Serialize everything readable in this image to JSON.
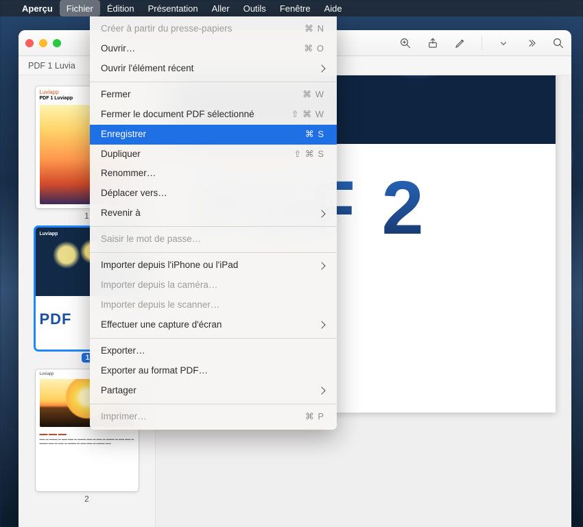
{
  "menubar": {
    "app": "Aperçu",
    "menus": [
      "Fichier",
      "Édition",
      "Présentation",
      "Aller",
      "Outils",
      "Fenêtre",
      "Aide"
    ],
    "active_index": 0
  },
  "window": {
    "doc_title": "PDF 1 Luvia",
    "tool_icons": [
      "zoom-in-icon",
      "share-icon",
      "markup-icon",
      "dropdown-icon",
      "more-icon",
      "search-icon"
    ]
  },
  "sidebar": {
    "thumbs": [
      {
        "num": "1",
        "brand": "Luviapp",
        "title": "PDF 1 Luviapp"
      },
      {
        "num": "1",
        "brand": "Luviapp",
        "big": "PDF",
        "selected": true,
        "badge": "1"
      },
      {
        "num": "2",
        "brand": "Luviapp",
        "heading": "",
        "sub": ""
      }
    ]
  },
  "page": {
    "big_title": "PDF 2"
  },
  "menu": {
    "items": [
      {
        "t": "row",
        "label": "Créer à partir du presse-papiers",
        "shortcut": "⌘ N",
        "disabled": true
      },
      {
        "t": "row",
        "label": "Ouvrir…",
        "shortcut": "⌘ O"
      },
      {
        "t": "row",
        "label": "Ouvrir l'élément récent",
        "submenu": true
      },
      {
        "t": "sep"
      },
      {
        "t": "row",
        "label": "Fermer",
        "shortcut": "⌘ W"
      },
      {
        "t": "row",
        "label": "Fermer le document PDF sélectionné",
        "shortcut": "⇧ ⌘ W"
      },
      {
        "t": "row",
        "label": "Enregistrer",
        "shortcut": "⌘ S",
        "selected": true
      },
      {
        "t": "row",
        "label": "Dupliquer",
        "shortcut": "⇧ ⌘ S"
      },
      {
        "t": "row",
        "label": "Renommer…"
      },
      {
        "t": "row",
        "label": "Déplacer vers…"
      },
      {
        "t": "row",
        "label": "Revenir à",
        "submenu": true
      },
      {
        "t": "sep"
      },
      {
        "t": "row",
        "label": "Saisir le mot de passe…",
        "disabled": true
      },
      {
        "t": "sep"
      },
      {
        "t": "row",
        "label": "Importer depuis l'iPhone ou l'iPad",
        "submenu": true
      },
      {
        "t": "row",
        "label": "Importer depuis la caméra…",
        "disabled": true
      },
      {
        "t": "row",
        "label": "Importer depuis le scanner…",
        "disabled": true
      },
      {
        "t": "row",
        "label": "Effectuer une capture d'écran",
        "submenu": true
      },
      {
        "t": "sep"
      },
      {
        "t": "row",
        "label": "Exporter…"
      },
      {
        "t": "row",
        "label": "Exporter au format PDF…"
      },
      {
        "t": "row",
        "label": "Partager",
        "submenu": true
      },
      {
        "t": "sep"
      },
      {
        "t": "row",
        "label": "Imprimer…",
        "shortcut": "⌘ P",
        "disabled": true
      }
    ]
  }
}
